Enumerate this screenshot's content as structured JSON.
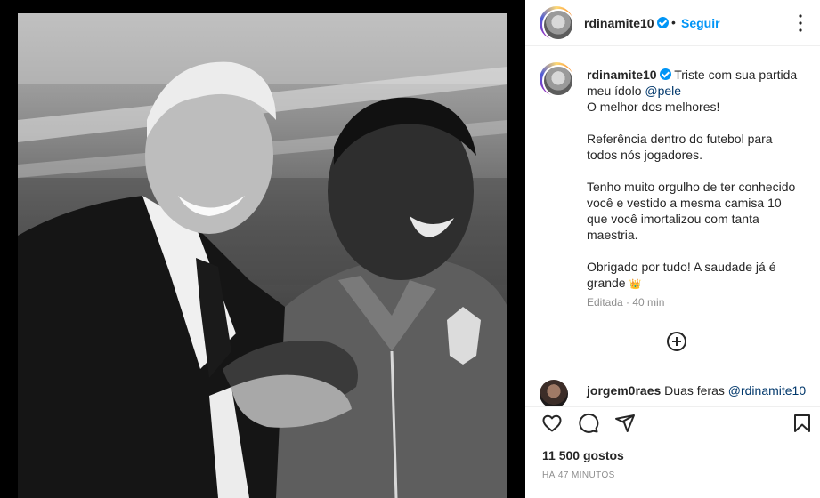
{
  "post": {
    "username": "rdinamite10",
    "separator": "•",
    "follow_label": "Seguir",
    "caption": {
      "username": "rdinamite10",
      "first_line": "Triste com sua partida meu ídolo ",
      "mention": "@pele",
      "lines": [
        "O melhor dos melhores!",
        "",
        "Referência dentro do futebol para todos nós jogadores.",
        "",
        "Tenho muito orgulho de ter conhecido você e vestido a mesma camisa 10 que você imortalizou com tanta maestria.",
        "",
        "Obrigado por tudo! A saudade já é grande"
      ],
      "emoji": "👑"
    },
    "meta": "Editada · 40 min",
    "comment": {
      "username": "jorgem0raes",
      "text": "Duas feras ",
      "mention": "@rdinamite10"
    },
    "likes": "11 500 gostos",
    "time_ago": "HÁ 47 MINUTOS",
    "icons": {
      "like": "heart-icon",
      "comment": "comment-icon",
      "share": "share-icon",
      "save": "bookmark-icon",
      "more": "more-options-icon",
      "add": "add-circle-icon"
    },
    "colors": {
      "accent": "#0095f6",
      "mention": "#00376b",
      "muted": "#8e8e8e"
    }
  }
}
